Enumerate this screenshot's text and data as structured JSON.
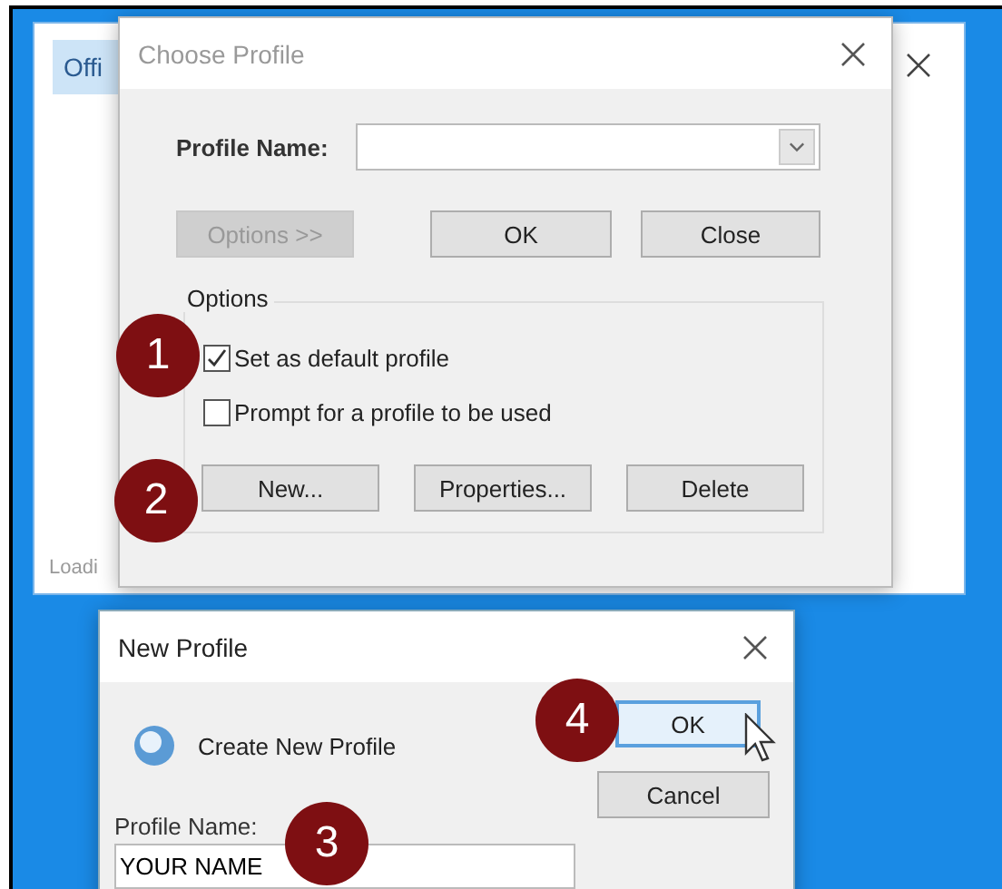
{
  "background_window": {
    "tab": {
      "label": "Offi",
      "selected": true
    },
    "status": "Loadi"
  },
  "choose_profile": {
    "title": "Choose Profile",
    "profile_name_label": "Profile Name:",
    "buttons": [
      {
        "label": "Options >>",
        "disabled": true
      },
      {
        "label": "OK",
        "disabled": false
      },
      {
        "label": "Close",
        "disabled": false
      }
    ],
    "options": {
      "label": "Options",
      "checkboxes": [
        {
          "label": "Set as default profile",
          "checked": true
        },
        {
          "label": "Prompt for a profile to be used",
          "checked": false
        }
      ],
      "buttons": [
        {
          "label": "New..."
        },
        {
          "label": "Properties..."
        },
        {
          "label": "Delete"
        }
      ]
    }
  },
  "new_profile": {
    "title": "New Profile",
    "heading": "Create New Profile",
    "profile_name_label": "Profile Name:",
    "profile_name_value": "YOUR NAME",
    "buttons": [
      {
        "label": "OK",
        "focused": true
      },
      {
        "label": "Cancel",
        "focused": false
      }
    ]
  },
  "markers": [
    {
      "number": "1"
    },
    {
      "number": "2"
    },
    {
      "number": "3"
    },
    {
      "number": "4"
    }
  ]
}
